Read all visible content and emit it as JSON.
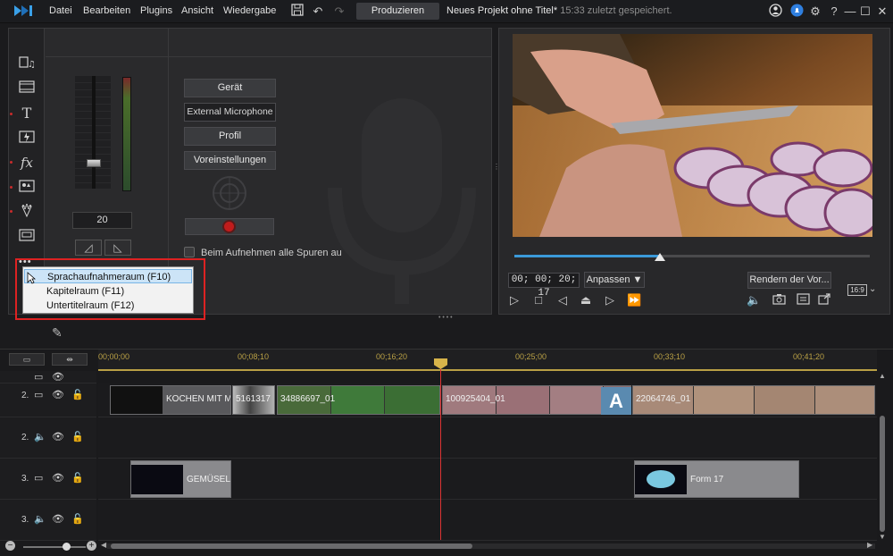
{
  "menu": [
    "Datei",
    "Bearbeiten",
    "Plugins",
    "Ansicht",
    "Wiedergabe"
  ],
  "toolbar": {
    "produce_label": "Produzieren",
    "project_title": "Neues Projekt ohne Titel*",
    "saved_status": "15:33 zuletzt gespeichert."
  },
  "recorder": {
    "level_value": "20",
    "device_label": "Gerät",
    "device_value": "External Microphone",
    "profile_label": "Profil",
    "settings_label": "Voreinstellungen",
    "mute_all_label": "Beim Aufnehmen alle Spuren au"
  },
  "room_menu": {
    "more_dots": "•••",
    "items": [
      "Sprachaufnahmeraum (F10)",
      "Kapitelraum (F11)",
      "Untertitelraum (F12)"
    ],
    "selected_index": 0
  },
  "preview": {
    "timecode": "00; 00; 20; 17",
    "fit_label": "Anpassen ▼",
    "render_label": "Rendern der Vor...",
    "aspect_label": "16:9",
    "progress_fraction": 0.41
  },
  "timeline": {
    "ruler_labels": [
      "00;00;00",
      "00;08;10",
      "00;16;20",
      "00;25;00",
      "00;33;10",
      "00;41;20"
    ],
    "tracks": [
      {
        "num": "2.",
        "type": "video"
      },
      {
        "num": "2.",
        "type": "audio"
      },
      {
        "num": "3.",
        "type": "video"
      },
      {
        "num": "3.",
        "type": "audio"
      }
    ],
    "clips_track2": [
      {
        "label": "KOCHEN MIT M"
      },
      {
        "label": "5161317"
      },
      {
        "label": "34886697_01"
      },
      {
        "label": "100925404_01"
      },
      {
        "label": "22064746_01"
      }
    ],
    "clips_track3": [
      {
        "label": "GEMÜSELA"
      },
      {
        "label": "Form 17"
      }
    ]
  },
  "colors": {
    "accent_blue": "#3b9ad9",
    "record_red": "#c11c1c",
    "ruler_gold": "#b9a045",
    "playhead_red": "#dd3333"
  }
}
